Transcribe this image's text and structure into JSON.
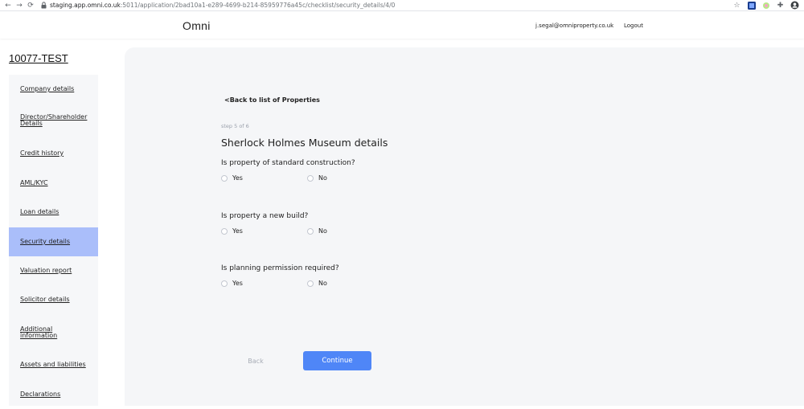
{
  "browser": {
    "url_host": "staging.app.omni.co.uk",
    "url_path": ":5011/application/2bad10a1-e289-4699-b214-85959776a45c/checklist/security_details/4/0"
  },
  "header": {
    "brand": "Omni",
    "user_email": "j.segal@omniproperty.co.uk",
    "logout": "Logout"
  },
  "application_id": "10077-TEST",
  "sidebar": {
    "items": [
      {
        "label": "Company details"
      },
      {
        "label": "Director/Shareholder Details"
      },
      {
        "label": "Credit history"
      },
      {
        "label": "AML/KYC"
      },
      {
        "label": "Loan details"
      },
      {
        "label": "Security details",
        "active": true
      },
      {
        "label": "Valuation report"
      },
      {
        "label": "Solicitor details"
      },
      {
        "label": "Additional information"
      },
      {
        "label": "Assets and liabilities"
      },
      {
        "label": "Declarations"
      }
    ]
  },
  "main": {
    "back_link": "<Back to list of Properties",
    "step": "step 5 of 6",
    "title": "Sherlock Holmes Museum details",
    "questions": [
      {
        "label": "Is property of standard construction?",
        "options": [
          "Yes",
          "No"
        ]
      },
      {
        "label": "Is property a new build?",
        "options": [
          "Yes",
          "No"
        ]
      },
      {
        "label": "Is planning permission required?",
        "options": [
          "Yes",
          "No"
        ]
      }
    ],
    "back_button": "Back",
    "continue_button": "Continue"
  },
  "colors": {
    "accent": "#4f86f7",
    "active_nav": "#aabefa",
    "panel_bg": "#f5f6f8"
  }
}
